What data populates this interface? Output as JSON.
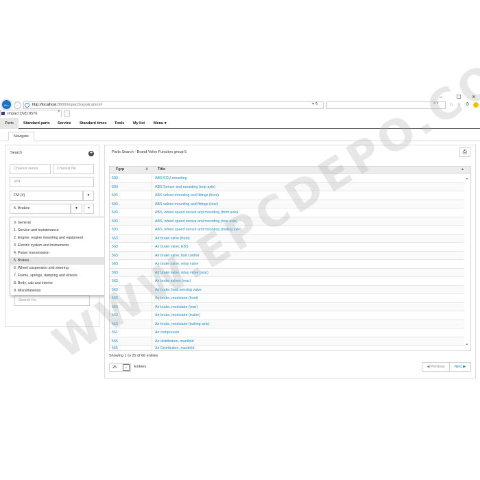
{
  "browser": {
    "url_host": "http://localhost",
    "url_rest": ":8800/impact3/application/#",
    "url_tools": "▾ ↻",
    "search_icons": "⌕ ▾",
    "tab_title": "Impact DVD 8576",
    "tab_close": "×",
    "window_buttons": [
      "–",
      "☐",
      "✕"
    ],
    "toolbar_icons": "⌂ ☆ ⚙"
  },
  "app_nav": {
    "items": [
      "Parts",
      "Standard parts",
      "Service",
      "Standard times",
      "Tools",
      "My list",
      "Menu ▾"
    ]
  },
  "subtab": {
    "label": "Navigate"
  },
  "left_panel": {
    "title": "Search",
    "chassis_series_placeholder": "Chassis series",
    "chassis_no_placeholder": "Chassis No.",
    "vin_placeholder": "VIN",
    "fm_value": "FM (4)",
    "group_value": "5. Brakes",
    "search_for_placeholder": "Search for"
  },
  "menu": {
    "items": [
      {
        "label": "0. General",
        "selected": false
      },
      {
        "label": "1. Service and maintenance",
        "selected": false
      },
      {
        "label": "2. Engine, engine mounting and equipment",
        "selected": false
      },
      {
        "label": "3. Electric system and instruments",
        "selected": false
      },
      {
        "label": "4. Power transmission",
        "selected": false
      },
      {
        "label": "5. Brakes",
        "selected": true
      },
      {
        "label": "6. Wheel suspension and steering",
        "selected": false
      },
      {
        "label": "7. Frame, springs, damping and wheels",
        "selected": false
      },
      {
        "label": "8. Body, cab and interior",
        "selected": false
      },
      {
        "label": "9. Miscellaneous",
        "selected": false
      }
    ]
  },
  "right_panel": {
    "breadcrumb": "Parts Search - Brand Volvo Function group 5",
    "columns": [
      "Fgrp",
      "Title"
    ],
    "rows": [
      {
        "fgrp": "593",
        "title": "ABS ECU,mounting"
      },
      {
        "fgrp": "593",
        "title": "ABS Sensor and mounting (rear axle)"
      },
      {
        "fgrp": "593",
        "title": "ABS valves mounting and fittings (front)"
      },
      {
        "fgrp": "593",
        "title": "ABS valves mounting and fittings (rear)"
      },
      {
        "fgrp": "593",
        "title": "ABS, wheel speed sensor and mounting (front axle)"
      },
      {
        "fgrp": "593",
        "title": "ABS, wheel speed sensor and mounting (rear axle)"
      },
      {
        "fgrp": "593",
        "title": "ABS, wheel speed sensor and mounting (trailing axle)"
      },
      {
        "fgrp": "563",
        "title": "Air brake valve (front)"
      },
      {
        "fgrp": "563",
        "title": "Air brake valve, EBS"
      },
      {
        "fgrp": "563",
        "title": "Air brake valve, foot control"
      },
      {
        "fgrp": "563",
        "title": "Air brake valve, relay valve"
      },
      {
        "fgrp": "563",
        "title": "Air brake valve, relay valve (rear)"
      },
      {
        "fgrp": "563",
        "title": "Air brake valves (rear)"
      },
      {
        "fgrp": "563",
        "title": "Air brake, load sensing valve"
      },
      {
        "fgrp": "563",
        "title": "Air brake, modulator (front)"
      },
      {
        "fgrp": "563",
        "title": "Air brake, modulator (rear)"
      },
      {
        "fgrp": "563",
        "title": "Air brake, modulator (trailer)"
      },
      {
        "fgrp": "563",
        "title": "Air brake, modulator (trailing axle)"
      },
      {
        "fgrp": "561",
        "title": "Air compressor"
      },
      {
        "fgrp": "565",
        "title": "Air distribution, manifold"
      },
      {
        "fgrp": "565",
        "title": "Air Distribution, manifold"
      }
    ],
    "showing_text": "Showing 1 to 25 of 66 entries",
    "page_size": "25",
    "entries_label": "Entries",
    "prev_label": "◀ Previous",
    "next_label": "Next ▶"
  },
  "watermark": "WWW.EPCDEPO.COM",
  "colors": {
    "link": "#1a8cc8",
    "back_button": "#1e73be",
    "selected_menu": "#e3e3e3"
  }
}
